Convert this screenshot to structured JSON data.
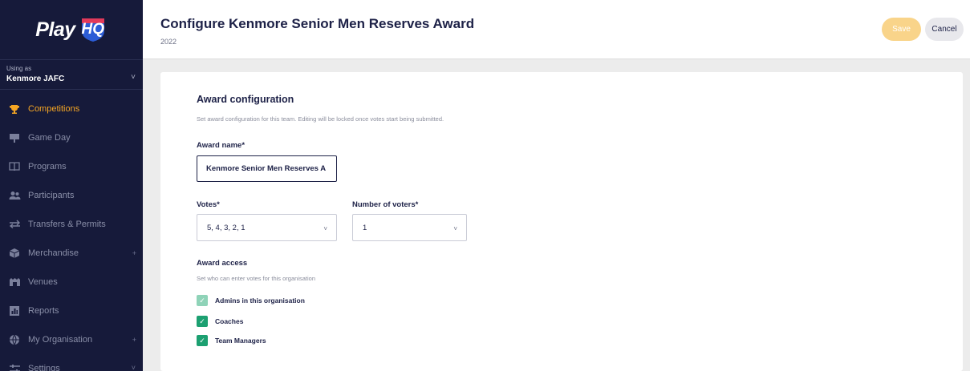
{
  "brand": {
    "logo_text": "Play",
    "logo_badge": "HQ",
    "accent": "#f6a623",
    "sidebar_bg": "#161a3a"
  },
  "org": {
    "using_as_label": "Using as",
    "name": "Kenmore JAFC"
  },
  "nav": [
    {
      "label": "Competitions",
      "icon": "trophy-icon",
      "active": true
    },
    {
      "label": "Game Day",
      "icon": "game-day-icon"
    },
    {
      "label": "Programs",
      "icon": "book-icon"
    },
    {
      "label": "Participants",
      "icon": "people-icon"
    },
    {
      "label": "Transfers & Permits",
      "icon": "transfer-icon"
    },
    {
      "label": "Merchandise",
      "icon": "box-icon",
      "expand": "+"
    },
    {
      "label": "Venues",
      "icon": "venue-icon"
    },
    {
      "label": "Reports",
      "icon": "reports-icon"
    },
    {
      "label": "My Organisation",
      "icon": "globe-icon",
      "expand": "+"
    },
    {
      "label": "Settings",
      "icon": "sliders-icon",
      "expand": "˅"
    }
  ],
  "header": {
    "title": "Configure Kenmore Senior Men Reserves Award",
    "subtitle": "2022",
    "save_label": "Save",
    "cancel_label": "Cancel"
  },
  "award_config": {
    "title": "Award configuration",
    "description": "Set award configuration for this team. Editing will be locked once votes start being submitted.",
    "award_name_label": "Award name*",
    "award_name_value": "Kenmore Senior Men Reserves A",
    "votes_label": "Votes*",
    "votes_value": "5, 4, 3, 2, 1",
    "voters_label": "Number of voters*",
    "voters_value": "1"
  },
  "award_access": {
    "title": "Award access",
    "description": "Set who can enter votes for this organisation",
    "options": [
      {
        "label": "Admins in this organisation",
        "checked": true,
        "disabled": true
      },
      {
        "label": "Coaches",
        "checked": true,
        "disabled": false
      },
      {
        "label": "Team Managers",
        "checked": true,
        "disabled": false
      }
    ]
  }
}
